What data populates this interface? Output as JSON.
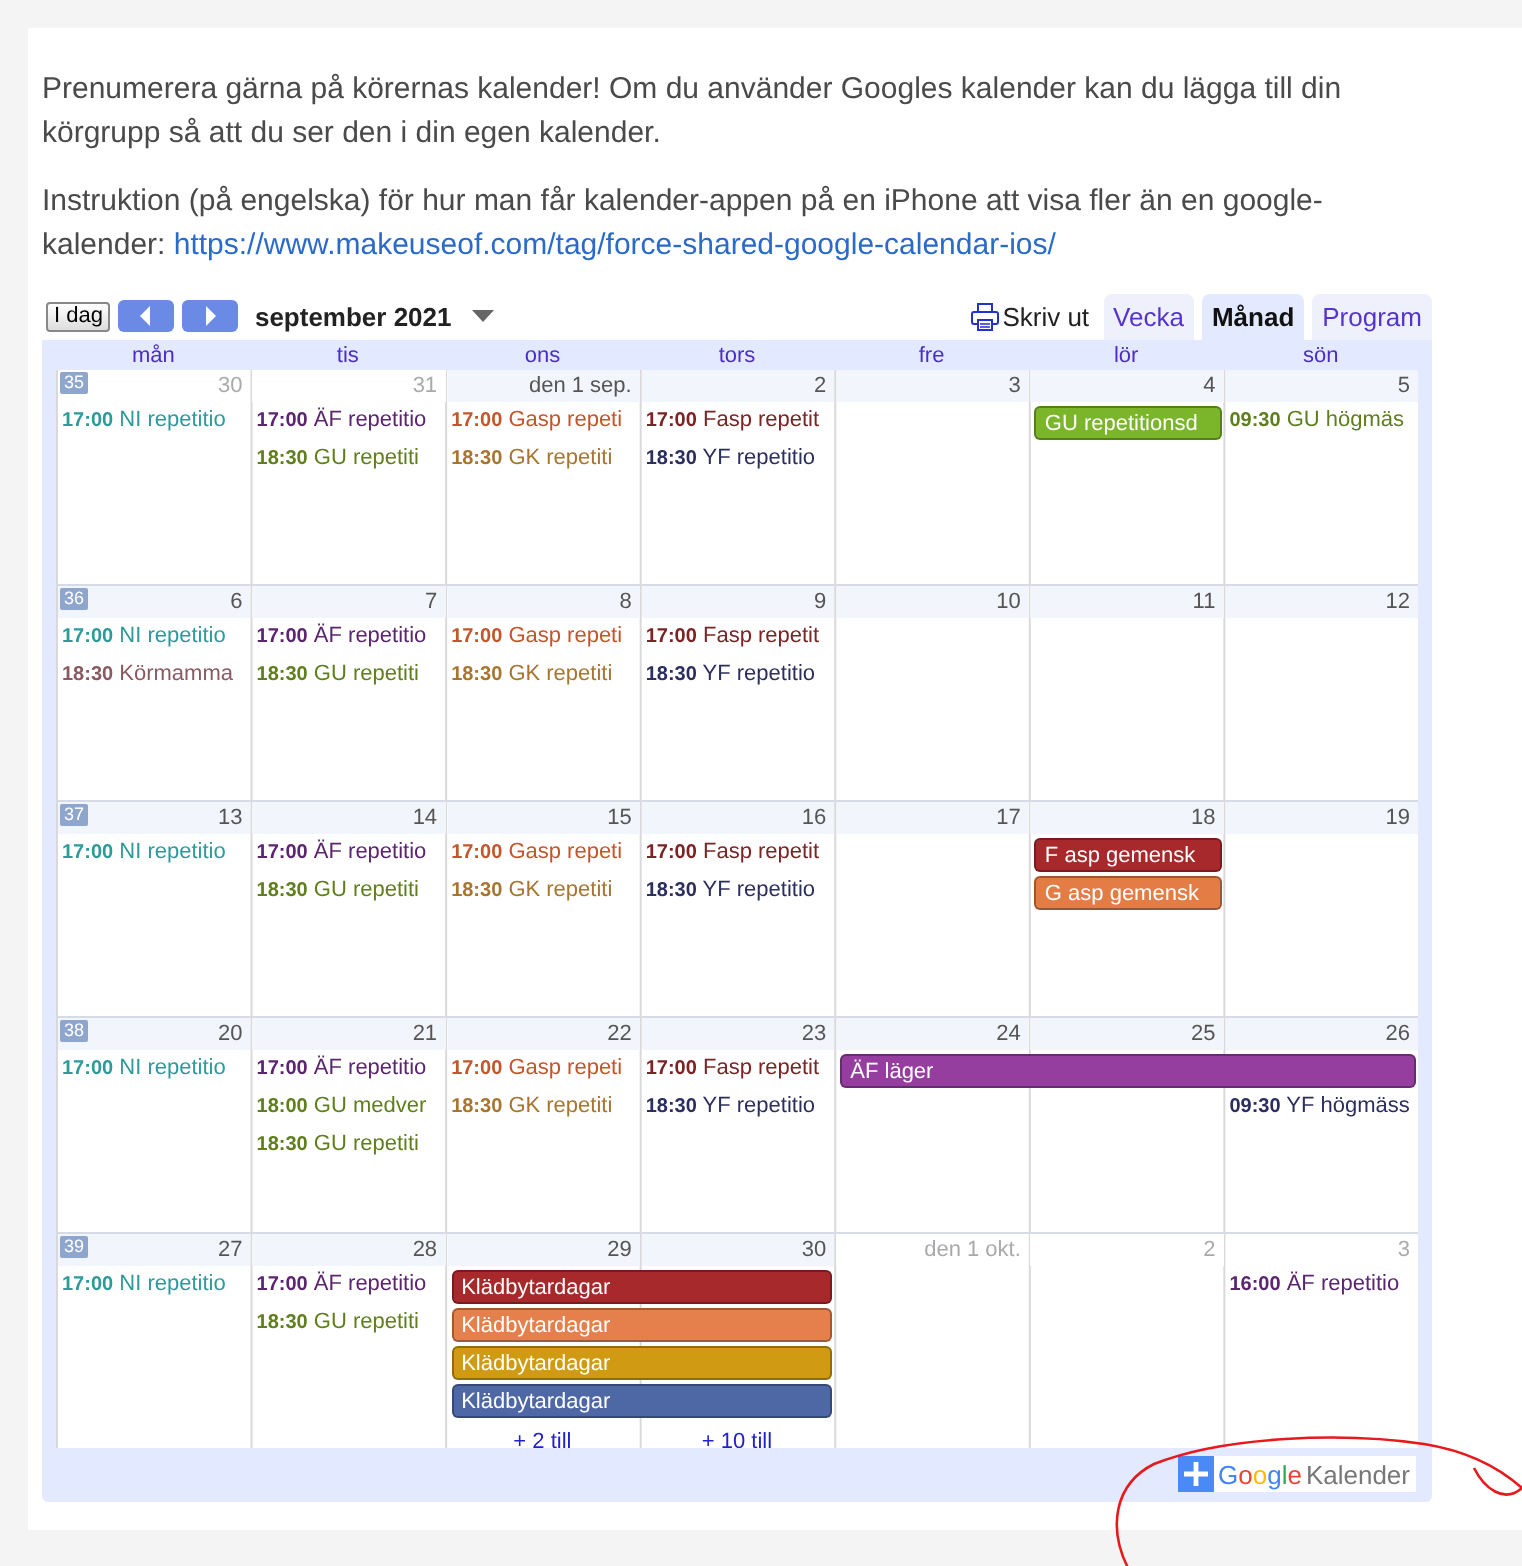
{
  "intro": [
    {
      "text": "Prenumerera gärna på körernas kalender! Om du använder Googles kalender kan du lägga till din körgrupp så att du ser den i din egen kalender."
    },
    {
      "text": "Instruktion (på engelska) för hur man får kalender-appen på en iPhone att visa fler än en google-kalender: ",
      "link": "https://www.makeuseof.com/tag/force-shared-google-calendar-ios/"
    }
  ],
  "calendar": {
    "today_button": "I dag",
    "title": "september 2021",
    "print": "Skriv ut",
    "tabs": [
      {
        "label": "Vecka",
        "selected": false
      },
      {
        "label": "Månad",
        "selected": true
      },
      {
        "label": "Program",
        "selected": false
      }
    ],
    "weekdays": [
      "mån",
      "tis",
      "ons",
      "tors",
      "fre",
      "lör",
      "sön"
    ],
    "weeks": [
      {
        "number": "35",
        "days": [
          {
            "date": "30",
            "muted": true,
            "events": [
              {
                "kind": "timed",
                "time": "17:00",
                "title": "NI repetitio",
                "color": "#2e9a9a"
              }
            ]
          },
          {
            "date": "31",
            "muted": true,
            "events": [
              {
                "kind": "timed",
                "time": "17:00",
                "title": "ÄF repetitio",
                "color": "#5b2570"
              },
              {
                "kind": "timed",
                "time": "18:30",
                "title": "GU repetiti",
                "color": "#5f7f1f"
              }
            ]
          },
          {
            "date": "den 1 sep.",
            "muted": false,
            "events": [
              {
                "kind": "timed",
                "time": "17:00",
                "title": "Gasp repeti",
                "color": "#c4562c"
              },
              {
                "kind": "timed",
                "time": "18:30",
                "title": "GK repetiti",
                "color": "#a8752e"
              }
            ]
          },
          {
            "date": "2",
            "muted": false,
            "events": [
              {
                "kind": "timed",
                "time": "17:00",
                "title": "Fasp repetit",
                "color": "#7a2424"
              },
              {
                "kind": "timed",
                "time": "18:30",
                "title": "YF repetitio",
                "color": "#2c2f5e"
              }
            ]
          },
          {
            "date": "3",
            "muted": false
          },
          {
            "date": "4",
            "muted": false,
            "events": [
              {
                "kind": "bar",
                "title": "GU repetitionsd",
                "color": "#7ab52a"
              }
            ]
          },
          {
            "date": "5",
            "muted": false,
            "events": [
              {
                "kind": "timed",
                "time": "09:30",
                "title": "GU högmäs",
                "color": "#5f7f1f"
              }
            ]
          }
        ]
      },
      {
        "number": "36",
        "days": [
          {
            "date": "6",
            "muted": false,
            "events": [
              {
                "kind": "timed",
                "time": "17:00",
                "title": "NI repetitio",
                "color": "#2e9a9a"
              },
              {
                "kind": "timed",
                "time": "18:30",
                "title": "Körmamma",
                "color": "#8a5a62"
              }
            ]
          },
          {
            "date": "7",
            "muted": false,
            "events": [
              {
                "kind": "timed",
                "time": "17:00",
                "title": "ÄF repetitio",
                "color": "#5b2570"
              },
              {
                "kind": "timed",
                "time": "18:30",
                "title": "GU repetiti",
                "color": "#5f7f1f"
              }
            ]
          },
          {
            "date": "8",
            "muted": false,
            "events": [
              {
                "kind": "timed",
                "time": "17:00",
                "title": "Gasp repeti",
                "color": "#c4562c"
              },
              {
                "kind": "timed",
                "time": "18:30",
                "title": "GK repetiti",
                "color": "#a8752e"
              }
            ]
          },
          {
            "date": "9",
            "muted": false,
            "events": [
              {
                "kind": "timed",
                "time": "17:00",
                "title": "Fasp repetit",
                "color": "#7a2424"
              },
              {
                "kind": "timed",
                "time": "18:30",
                "title": "YF repetitio",
                "color": "#2c2f5e"
              }
            ]
          },
          {
            "date": "10",
            "muted": false
          },
          {
            "date": "11",
            "muted": false
          },
          {
            "date": "12",
            "muted": false
          }
        ]
      },
      {
        "number": "37",
        "days": [
          {
            "date": "13",
            "muted": false,
            "events": [
              {
                "kind": "timed",
                "time": "17:00",
                "title": "NI repetitio",
                "color": "#2e9a9a"
              }
            ]
          },
          {
            "date": "14",
            "muted": false,
            "events": [
              {
                "kind": "timed",
                "time": "17:00",
                "title": "ÄF repetitio",
                "color": "#5b2570"
              },
              {
                "kind": "timed",
                "time": "18:30",
                "title": "GU repetiti",
                "color": "#5f7f1f"
              }
            ]
          },
          {
            "date": "15",
            "muted": false,
            "events": [
              {
                "kind": "timed",
                "time": "17:00",
                "title": "Gasp repeti",
                "color": "#c4562c"
              },
              {
                "kind": "timed",
                "time": "18:30",
                "title": "GK repetiti",
                "color": "#a8752e"
              }
            ]
          },
          {
            "date": "16",
            "muted": false,
            "events": [
              {
                "kind": "timed",
                "time": "17:00",
                "title": "Fasp repetit",
                "color": "#7a2424"
              },
              {
                "kind": "timed",
                "time": "18:30",
                "title": "YF repetitio",
                "color": "#2c2f5e"
              }
            ]
          },
          {
            "date": "17",
            "muted": false
          },
          {
            "date": "18",
            "muted": false,
            "events": [
              {
                "kind": "bar",
                "title": "F asp gemensk",
                "color": "#a8292b"
              },
              {
                "kind": "bar",
                "title": "G asp gemensk",
                "color": "#e47c46"
              }
            ]
          },
          {
            "date": "19",
            "muted": false
          }
        ]
      },
      {
        "number": "38",
        "days": [
          {
            "date": "20",
            "muted": false,
            "events": [
              {
                "kind": "timed",
                "time": "17:00",
                "title": "NI repetitio",
                "color": "#2e9a9a"
              }
            ]
          },
          {
            "date": "21",
            "muted": false,
            "events": [
              {
                "kind": "timed",
                "time": "17:00",
                "title": "ÄF repetitio",
                "color": "#5b2570"
              },
              {
                "kind": "timed",
                "time": "18:00",
                "title": "GU medver",
                "color": "#5f7f1f"
              },
              {
                "kind": "timed",
                "time": "18:30",
                "title": "GU repetiti",
                "color": "#5f7f1f"
              }
            ]
          },
          {
            "date": "22",
            "muted": false,
            "events": [
              {
                "kind": "timed",
                "time": "17:00",
                "title": "Gasp repeti",
                "color": "#c4562c"
              },
              {
                "kind": "timed",
                "time": "18:30",
                "title": "GK repetiti",
                "color": "#a8752e"
              }
            ]
          },
          {
            "date": "23",
            "muted": false,
            "events": [
              {
                "kind": "timed",
                "time": "17:00",
                "title": "Fasp repetit",
                "color": "#7a2424"
              },
              {
                "kind": "timed",
                "time": "18:30",
                "title": "YF repetitio",
                "color": "#2c2f5e"
              }
            ]
          },
          {
            "date": "24",
            "muted": false,
            "events": [
              {
                "kind": "bar",
                "title": "ÄF läger",
                "color": "#953e9f"
              }
            ]
          },
          {
            "date": "25",
            "muted": false,
            "events": [
              {
                "kind": "continued"
              }
            ]
          },
          {
            "date": "26",
            "muted": false,
            "events": [
              {
                "kind": "continued"
              },
              {
                "kind": "timed",
                "time": "09:30",
                "title": "YF högmäss",
                "color": "#2c2f5e"
              }
            ]
          }
        ]
      },
      {
        "number": "39",
        "days": [
          {
            "date": "27",
            "muted": false,
            "events": [
              {
                "kind": "timed",
                "time": "17:00",
                "title": "NI repetitio",
                "color": "#2e9a9a"
              }
            ]
          },
          {
            "date": "28",
            "muted": false,
            "events": [
              {
                "kind": "timed",
                "time": "17:00",
                "title": "ÄF repetitio",
                "color": "#5b2570"
              },
              {
                "kind": "timed",
                "time": "18:30",
                "title": "GU repetiti",
                "color": "#5f7f1f"
              }
            ]
          },
          {
            "date": "29",
            "muted": false,
            "events": [
              {
                "kind": "bar",
                "title": "Klädbytardagar",
                "color": "#a8292b"
              },
              {
                "kind": "bar",
                "title": "Klädbytardagar",
                "color": "#e5804c"
              },
              {
                "kind": "bar",
                "title": "Klädbytardagar",
                "color": "#d19a13"
              },
              {
                "kind": "bar",
                "title": "Klädbytardagar",
                "color": "#4e68a6"
              },
              {
                "kind": "more",
                "title": "+ 2 till"
              }
            ]
          },
          {
            "date": "30",
            "muted": false,
            "events": [
              {
                "kind": "continued"
              },
              {
                "kind": "continued"
              },
              {
                "kind": "continued"
              },
              {
                "kind": "continued"
              },
              {
                "kind": "more",
                "title": "+ 10 till"
              }
            ]
          },
          {
            "date": "den 1 okt.",
            "muted": true
          },
          {
            "date": "2",
            "muted": true
          },
          {
            "date": "3",
            "muted": true,
            "events": [
              {
                "kind": "timed",
                "time": "16:00",
                "title": "ÄF repetitio",
                "color": "#5b2570"
              }
            ]
          }
        ]
      }
    ],
    "footer": {
      "brand": "Google",
      "label": "Kalender"
    }
  }
}
